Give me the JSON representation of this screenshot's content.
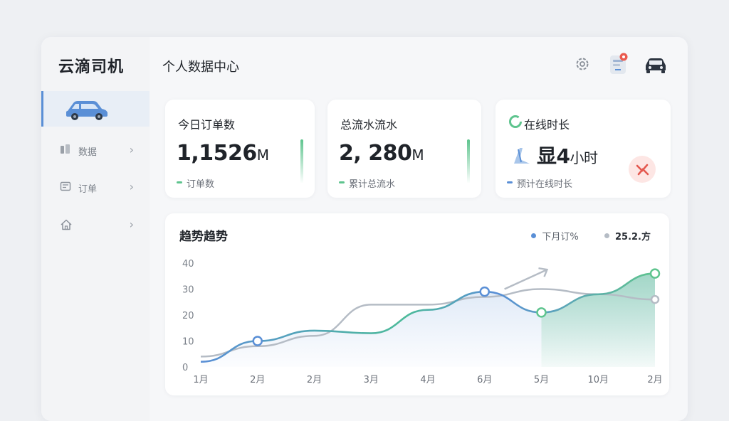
{
  "app": {
    "title": "云滴司机"
  },
  "sidebar": {
    "items": [
      {
        "label": "",
        "icon": "car-icon",
        "active": true
      },
      {
        "label": "数据",
        "icon": "chart-icon"
      },
      {
        "label": "订单",
        "icon": "list-icon"
      },
      {
        "label": "",
        "icon": "home-icon"
      }
    ]
  },
  "header": {
    "title": "个人数据中心",
    "icons": [
      "gear-icon",
      "notification-icon",
      "car-icon"
    ]
  },
  "cards": [
    {
      "title": "今日订单数",
      "value": "1,1526",
      "unit": "M",
      "sub": "订单数",
      "accent": "#5ec48e"
    },
    {
      "title": "总流水流水",
      "value": "2, 280",
      "unit": "M",
      "sub": "累计总流水",
      "accent": "#5ec48e"
    },
    {
      "title": "在线时长",
      "value": "显4",
      "unit": "小时",
      "sub": "预计在线时长",
      "accent": "#5a8fd6"
    }
  ],
  "chart_data": {
    "type": "line",
    "title": "趋势趋势",
    "categories": [
      "1月",
      "2月",
      "2月",
      "3月",
      "4月",
      "6月",
      "5月",
      "10月",
      "2月"
    ],
    "ylim": [
      0,
      40
    ],
    "yticks": [
      0,
      10,
      20,
      30,
      40
    ],
    "grid": false,
    "legend_position": "top-right",
    "series": [
      {
        "name": "下月订%",
        "color": "#5a8fd6",
        "values": [
          2,
          10,
          14,
          13,
          22,
          29,
          21,
          28,
          36
        ]
      },
      {
        "name": "25.2.方",
        "color": "#a9b2bd",
        "values": [
          4,
          8,
          12,
          24,
          24,
          27,
          30,
          28,
          26
        ]
      }
    ],
    "colors": {
      "blue": "#5a8fd6",
      "green": "#5ec48e",
      "gray": "#a9b2bd"
    }
  }
}
